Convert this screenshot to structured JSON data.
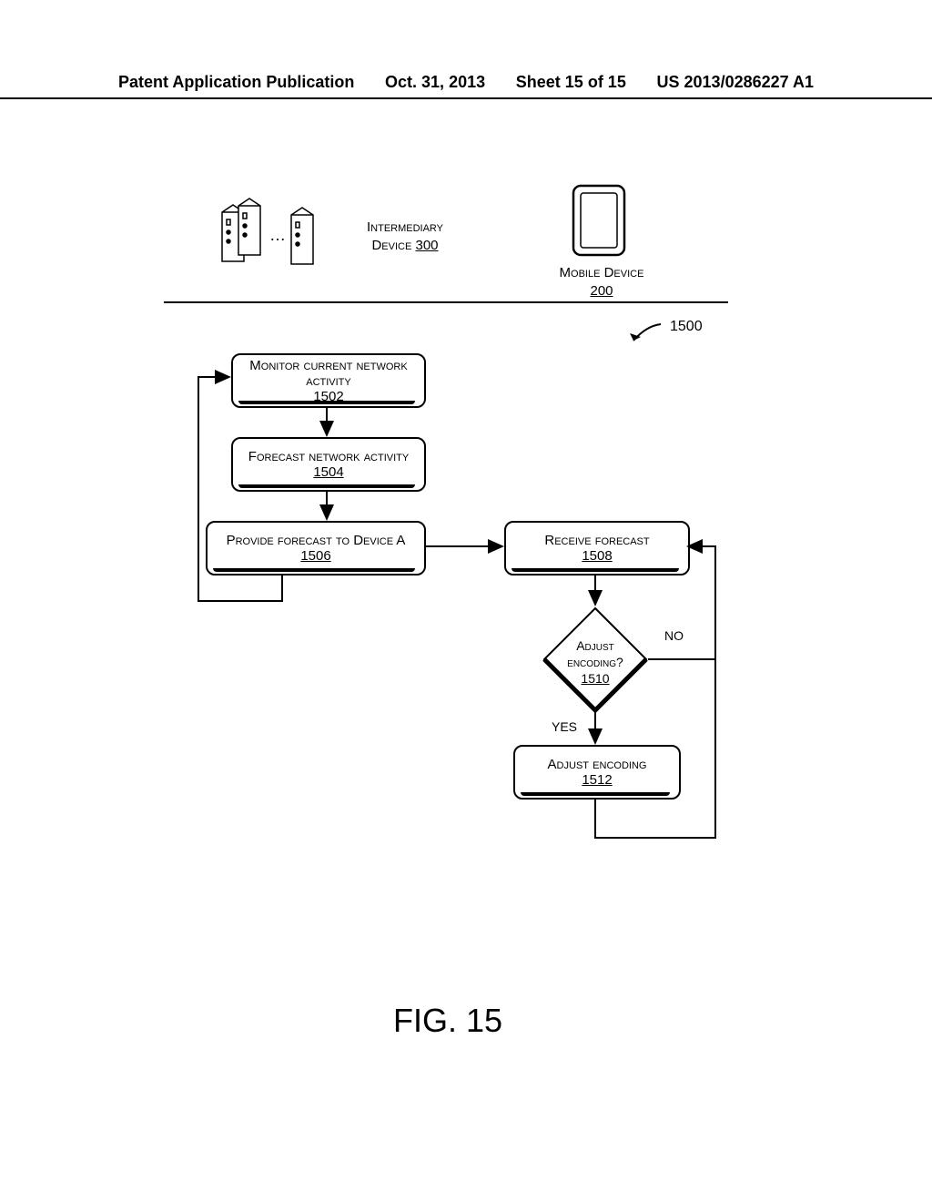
{
  "header": {
    "pub_label": "Patent Application Publication",
    "date": "Oct. 31, 2013",
    "sheet": "Sheet 15 of 15",
    "docnum": "US 2013/0286227 A1"
  },
  "devices": {
    "intermediary_label": "Intermediary",
    "intermediary_word_device": "Device",
    "intermediary_num": "300",
    "mobile_label": "Mobile Device",
    "mobile_num": "200"
  },
  "flowref": "1500",
  "boxes": {
    "b1502": {
      "text": "Monitor current network activity",
      "num": "1502"
    },
    "b1504": {
      "text": "Forecast network activity",
      "num": "1504"
    },
    "b1506": {
      "text": "Provide forecast to Device A",
      "num": "1506"
    },
    "b1508": {
      "text": "Receive forecast",
      "num": "1508"
    },
    "b1510": {
      "text_l1": "Adjust",
      "text_l2": "encoding?",
      "num": "1510"
    },
    "b1512": {
      "text": "Adjust encoding",
      "num": "1512"
    }
  },
  "branches": {
    "yes": "YES",
    "no": "NO"
  },
  "ellipsis": "…",
  "figure_caption": "FIG. 15"
}
